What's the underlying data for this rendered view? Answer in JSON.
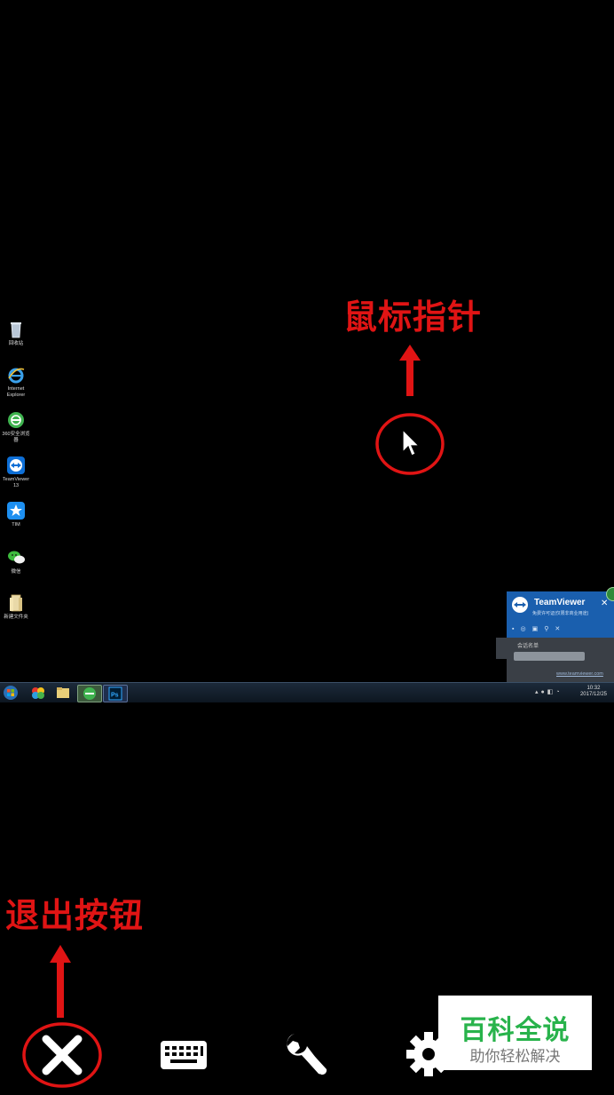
{
  "annotations": {
    "mouse_pointer": "鼠标指针",
    "exit_button": "退出按钮"
  },
  "desktop_icons": [
    {
      "label": "回收站",
      "icon": "recycle-bin-icon"
    },
    {
      "label": "Internet Explorer",
      "icon": "internet-explorer-icon"
    },
    {
      "label": "360安全浏览器",
      "icon": "360-browser-icon"
    },
    {
      "label": "TeamViewer 13",
      "icon": "teamviewer-icon"
    },
    {
      "label": "TIM",
      "icon": "tim-icon"
    },
    {
      "label": "微信",
      "icon": "wechat-icon"
    },
    {
      "label": "新建文件夹",
      "icon": "folder-icon"
    }
  ],
  "teamviewer": {
    "title": "TeamViewer",
    "subtitle": "免费许可证(仅限非商业用途)",
    "section": "会话名单",
    "link": "www.teamviewer.com"
  },
  "taskbar": {
    "time": "10:32",
    "date": "2017/12/25"
  },
  "watermark": {
    "main": "百科全说",
    "sub": "助你轻松解决"
  },
  "colors": {
    "annotation": "#e01414",
    "watermark_green": "#28b34b",
    "teamviewer_blue": "#1a5fae"
  }
}
